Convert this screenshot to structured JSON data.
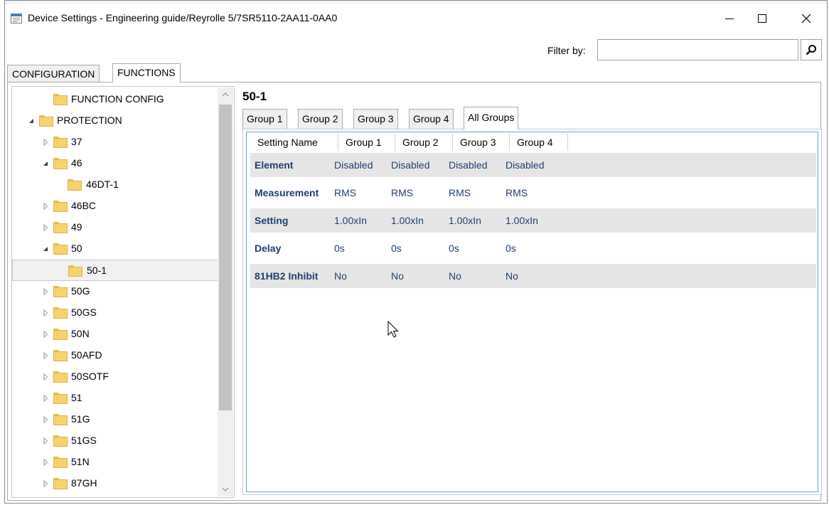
{
  "window": {
    "title": "Device Settings - Engineering guide/Reyrolle 5/7SR5110-2AA11-0AA0",
    "minimize_icon": "minimize-icon",
    "maximize_icon": "maximize-icon",
    "close_icon": "close-icon"
  },
  "filter": {
    "label": "Filter by:",
    "value": "",
    "button_icon": "search-icon"
  },
  "outer_tabs": [
    {
      "label": "CONFIGURATION"
    },
    {
      "label": "FUNCTIONS",
      "active": true
    }
  ],
  "tree": {
    "items": [
      {
        "label": "FUNCTION CONFIG",
        "level": 1,
        "expand": "none"
      },
      {
        "label": "PROTECTION",
        "level": 0,
        "expand": "expanded"
      },
      {
        "label": "37",
        "level": 1,
        "expand": "collapsed"
      },
      {
        "label": "46",
        "level": 1,
        "expand": "expanded"
      },
      {
        "label": "46DT-1",
        "level": 2,
        "expand": "none"
      },
      {
        "label": "46BC",
        "level": 1,
        "expand": "collapsed"
      },
      {
        "label": "49",
        "level": 1,
        "expand": "collapsed"
      },
      {
        "label": "50",
        "level": 1,
        "expand": "expanded"
      },
      {
        "label": "50-1",
        "level": 2,
        "expand": "none",
        "selected": true
      },
      {
        "label": "50G",
        "level": 1,
        "expand": "collapsed"
      },
      {
        "label": "50GS",
        "level": 1,
        "expand": "collapsed"
      },
      {
        "label": "50N",
        "level": 1,
        "expand": "collapsed"
      },
      {
        "label": "50AFD",
        "level": 1,
        "expand": "collapsed"
      },
      {
        "label": "50SOTF",
        "level": 1,
        "expand": "collapsed"
      },
      {
        "label": "51",
        "level": 1,
        "expand": "collapsed"
      },
      {
        "label": "51G",
        "level": 1,
        "expand": "collapsed"
      },
      {
        "label": "51GS",
        "level": 1,
        "expand": "collapsed"
      },
      {
        "label": "51N",
        "level": 1,
        "expand": "collapsed"
      },
      {
        "label": "87GH",
        "level": 1,
        "expand": "collapsed"
      }
    ]
  },
  "main": {
    "title": "50-1",
    "group_tabs": [
      {
        "label": "Group 1"
      },
      {
        "label": "Group 2"
      },
      {
        "label": "Group 3"
      },
      {
        "label": "Group 4"
      },
      {
        "label": "All Groups",
        "active": true
      }
    ],
    "grid": {
      "headers": [
        "Setting Name",
        "Group 1",
        "Group 2",
        "Group 3",
        "Group 4"
      ],
      "rows": [
        {
          "name": "Element",
          "values": [
            "Disabled",
            "Disabled",
            "Disabled",
            "Disabled"
          ]
        },
        {
          "name": "Measurement",
          "values": [
            "RMS",
            "RMS",
            "RMS",
            "RMS"
          ]
        },
        {
          "name": "Setting",
          "values": [
            "1.00xIn",
            "1.00xIn",
            "1.00xIn",
            "1.00xIn"
          ]
        },
        {
          "name": "Delay",
          "values": [
            "0s",
            "0s",
            "0s",
            "0s"
          ]
        },
        {
          "name": "81HB2 Inhibit",
          "values": [
            "No",
            "No",
            "No",
            "No"
          ]
        }
      ]
    }
  },
  "colors": {
    "row_alt": "#e6e6e6",
    "value_text": "#1f3e6e",
    "folder": "#f6d36c",
    "grid_focus_border": "#5fa7c4"
  }
}
